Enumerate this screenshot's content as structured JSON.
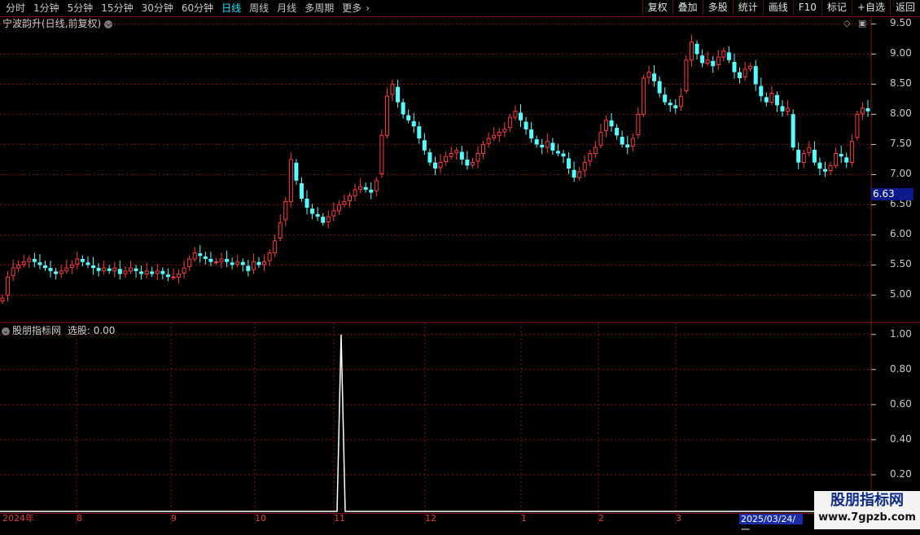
{
  "toolbar": {
    "periods": [
      "分时",
      "1分钟",
      "5分钟",
      "15分钟",
      "30分钟",
      "60分钟",
      "日线",
      "周线",
      "月线",
      "多周期",
      "更多"
    ],
    "active_period": "日线",
    "buttons": [
      "复权",
      "叠加",
      "多股",
      "统计",
      "画线",
      "F10",
      "标记",
      "+自选",
      "返回"
    ]
  },
  "main_panel": {
    "title": "宁波韵升(日线,前复权)",
    "last_price": "6.63",
    "colors": {
      "up": "#ff3b3b",
      "down": "#54ffff",
      "grid": "#8a1414",
      "bg": "#000000"
    }
  },
  "indicator_panel": {
    "title": "股朋指标网",
    "value_label": "选股: 0.00"
  },
  "date_axis": {
    "labels": [
      "2024年",
      "8",
      "9",
      "10",
      "11",
      "12",
      "1",
      "2",
      "3"
    ],
    "selected": "2025/03/24/一"
  },
  "watermark": {
    "title": "股朋指标网",
    "url": "www.7gpzb.com"
  },
  "chart_data": [
    {
      "type": "candlestick",
      "title": "宁波韵升(日线,前复权)",
      "ylim": [
        4.6,
        9.6
      ],
      "yticks": [
        "9.50",
        "9.00",
        "8.50",
        "8.00",
        "7.50",
        "7.00",
        "6.50",
        "6.00",
        "5.50",
        "5.00"
      ],
      "closes": [
        4.95,
        5.3,
        5.45,
        5.5,
        5.55,
        5.6,
        5.55,
        5.5,
        5.45,
        5.4,
        5.35,
        5.4,
        5.45,
        5.5,
        5.6,
        5.55,
        5.5,
        5.45,
        5.4,
        5.45,
        5.4,
        5.45,
        5.35,
        5.4,
        5.45,
        5.4,
        5.35,
        5.4,
        5.35,
        5.4,
        5.35,
        5.3,
        5.3,
        5.35,
        5.45,
        5.6,
        5.7,
        5.65,
        5.6,
        5.55,
        5.55,
        5.6,
        5.55,
        5.5,
        5.55,
        5.5,
        5.4,
        5.55,
        5.5,
        5.55,
        5.7,
        5.9,
        6.2,
        6.55,
        7.25,
        6.9,
        6.6,
        6.45,
        6.35,
        6.3,
        6.2,
        6.3,
        6.4,
        6.5,
        6.55,
        6.65,
        6.75,
        6.8,
        6.75,
        6.7,
        6.9,
        7.65,
        8.3,
        8.5,
        8.2,
        8.0,
        7.9,
        7.8,
        7.6,
        7.4,
        7.2,
        7.1,
        7.2,
        7.3,
        7.35,
        7.4,
        7.25,
        7.15,
        7.2,
        7.35,
        7.5,
        7.6,
        7.65,
        7.7,
        7.75,
        7.95,
        8.05,
        7.9,
        7.75,
        7.6,
        7.5,
        7.45,
        7.55,
        7.4,
        7.35,
        7.3,
        7.1,
        6.95,
        7.05,
        7.2,
        7.35,
        7.45,
        7.7,
        7.9,
        7.8,
        7.65,
        7.5,
        7.45,
        7.6,
        8.0,
        8.6,
        8.7,
        8.55,
        8.35,
        8.2,
        8.15,
        8.1,
        8.3,
        8.9,
        9.2,
        9.0,
        8.85,
        8.9,
        8.8,
        8.95,
        9.05,
        8.9,
        8.7,
        8.6,
        8.75,
        8.8,
        8.5,
        8.3,
        8.2,
        8.35,
        8.15,
        8.05,
        8.1,
        7.45,
        7.2,
        7.35,
        7.45,
        7.2,
        7.1,
        7.05,
        7.15,
        7.35,
        7.3,
        7.2,
        7.55,
        8.0,
        8.1,
        8.05
      ]
    },
    {
      "type": "line",
      "title": "股朋指标网",
      "ylim": [
        0,
        1.05
      ],
      "yticks": [
        "1.00",
        "0.80",
        "0.60",
        "0.40",
        "0.20"
      ],
      "spike_index": 74,
      "values_note": ""
    }
  ]
}
